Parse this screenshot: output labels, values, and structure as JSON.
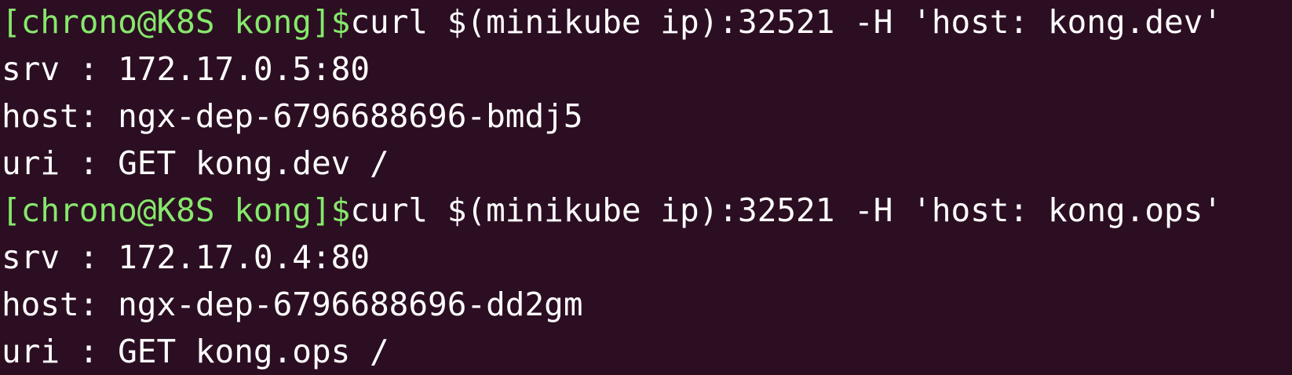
{
  "terminal": {
    "colors": {
      "background": "#2c0e22",
      "prompt": "#86e86c",
      "text": "#ffffff"
    },
    "blocks": [
      {
        "prompt": "[chrono@K8S kong]$",
        "command": "curl $(minikube ip):32521 -H 'host: kong.dev'",
        "output": [
          "srv : 172.17.0.5:80",
          "host: ngx-dep-6796688696-bmdj5",
          "uri : GET kong.dev /"
        ]
      },
      {
        "prompt": "[chrono@K8S kong]$",
        "command": "curl $(minikube ip):32521 -H 'host: kong.ops'",
        "output": [
          "srv : 172.17.0.4:80",
          "host: ngx-dep-6796688696-dd2gm",
          "uri : GET kong.ops /"
        ]
      }
    ]
  }
}
